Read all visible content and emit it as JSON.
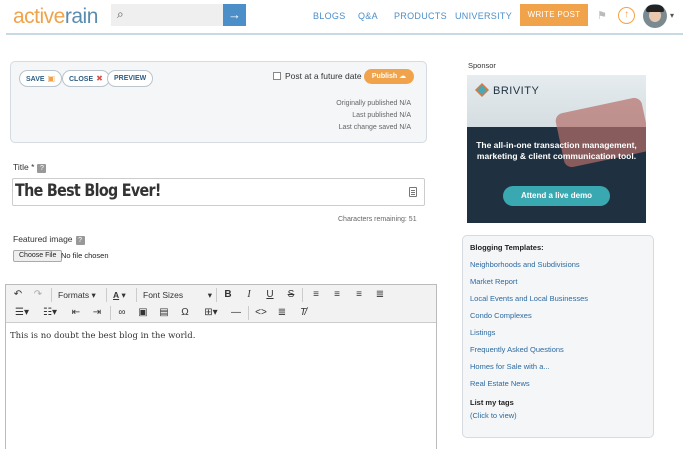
{
  "header": {
    "logo_part1": "active",
    "logo_part2": "rain",
    "nav": [
      "BLOGS",
      "Q&A",
      "PRODUCTS",
      "UNIVERSITY"
    ],
    "write_post_label": "WRITE POST"
  },
  "editor_panel": {
    "save_label": "SAVE",
    "close_label": "CLOSE",
    "preview_label": "PREVIEW",
    "future_label": "Post at a future date",
    "publish_label": "Publish",
    "originally_published": "Originally published N/A",
    "last_published": "Last published N/A",
    "last_change_saved": "Last change saved N/A"
  },
  "title_field": {
    "label": "Title *",
    "value": "The Best Blog Ever!",
    "chars_remaining": "Characters remaining: 51"
  },
  "featured_image": {
    "label": "Featured image",
    "choose_label": "Choose File",
    "status": "No file chosen"
  },
  "toolbar": {
    "formats_label": "Formats",
    "font_sizes_label": "Font Sizes"
  },
  "body_text": "This is no doubt the best blog in the world.",
  "sidebar": {
    "sponsor_label": "Sponsor",
    "ad": {
      "brand": "BRIVITY",
      "tagline": "The all-in-one transaction management, marketing & client communication tool.",
      "cta": "Attend a live demo"
    },
    "templates_heading": "Blogging Templates:",
    "templates": [
      "Neighborhoods and Subdivisions",
      "Market Report",
      "Local Events and Local Businesses",
      "Condo Complexes",
      "Listings",
      "Frequently Asked Questions",
      "Homes for Sale with a...",
      "Real Estate News"
    ],
    "my_tags_heading": "List my tags",
    "my_tags_link": "(Click to view)"
  },
  "colors": {
    "brand_orange": "#f0a34a",
    "brand_blue": "#4c8fc8",
    "link_blue": "#2c6aa0"
  }
}
